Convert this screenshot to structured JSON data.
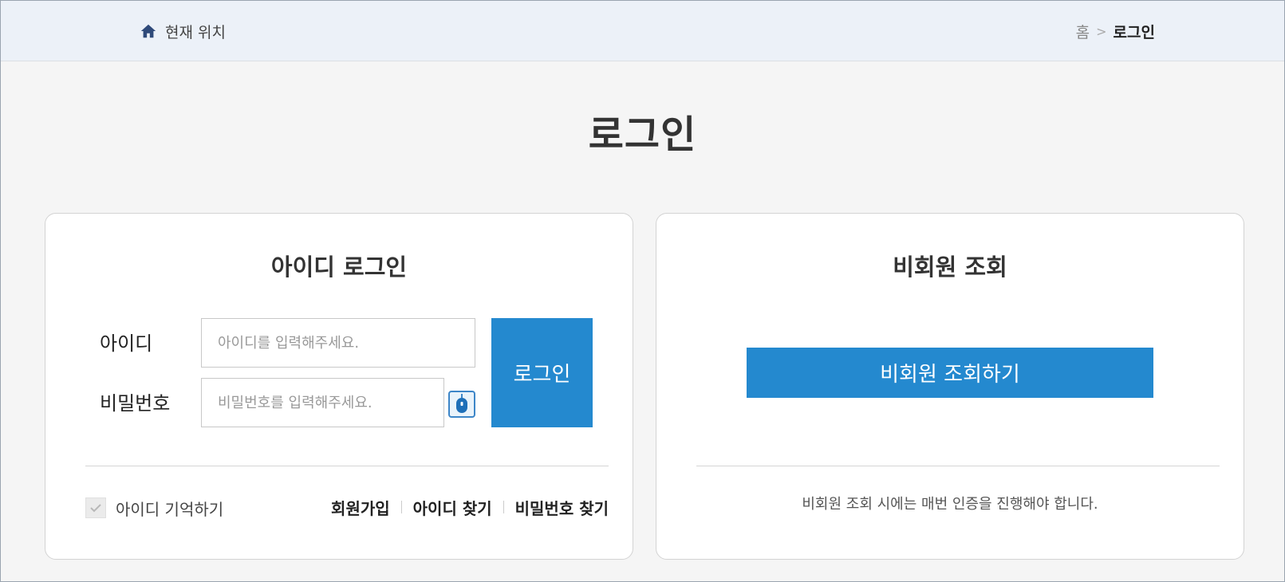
{
  "breadcrumb": {
    "location_label": "현재 위치",
    "home": "홈",
    "separator": ">",
    "current": "로그인"
  },
  "page": {
    "title": "로그인"
  },
  "id_login": {
    "heading": "아이디 로그인",
    "id_label": "아이디",
    "id_placeholder": "아이디를 입력해주세요.",
    "id_value": "",
    "pw_label": "비밀번호",
    "pw_placeholder": "비밀번호를 입력해주세요.",
    "pw_value": "",
    "login_button": "로그인",
    "remember_label": "아이디 기억하기",
    "remember_checked": true,
    "links": {
      "signup": "회원가입",
      "find_id": "아이디 찾기",
      "find_pw": "비밀번호 찾기"
    }
  },
  "guest": {
    "heading": "비회원 조회",
    "button": "비회원 조회하기",
    "note": "비회원 조회 시에는 매번 인증을 진행해야 합니다."
  },
  "colors": {
    "accent": "#2489cf",
    "crumb_bg": "#ecf1f8",
    "page_bg": "#f5f5f5",
    "home_icon": "#2f4a7a"
  },
  "icons": {
    "home": "home-icon",
    "keyboard": "mouse-icon",
    "check": "check-icon"
  }
}
